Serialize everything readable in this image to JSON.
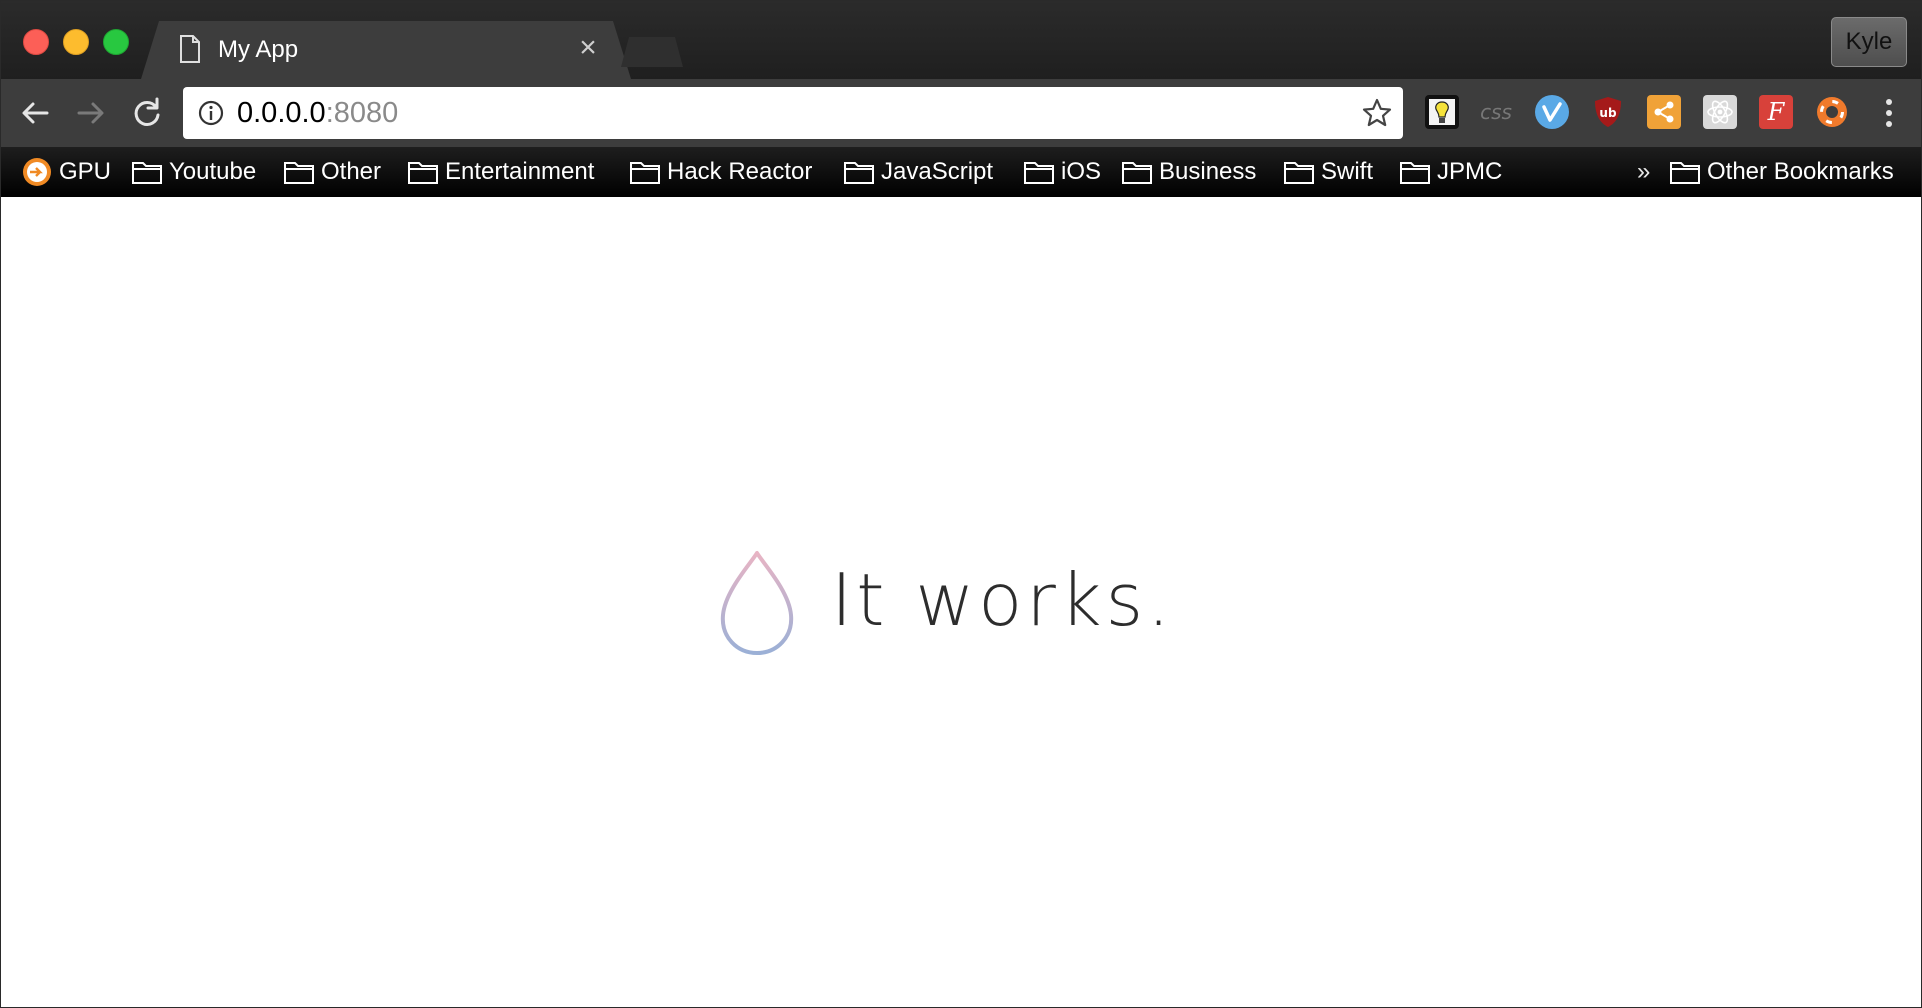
{
  "tab": {
    "title": "My App",
    "close_glyph": "×"
  },
  "profile": {
    "name": "Kyle"
  },
  "omnibox": {
    "host": "0.0.0.0",
    "port": ":8080"
  },
  "extensions": [
    {
      "name": "bulb-extension-icon",
      "label": ""
    },
    {
      "name": "css-extension-icon",
      "label": "css"
    },
    {
      "name": "vimeo-extension-icon",
      "label": ""
    },
    {
      "name": "ublock-extension-icon",
      "label": "ub"
    },
    {
      "name": "share-extension-icon",
      "label": ""
    },
    {
      "name": "react-extension-icon",
      "label": ""
    },
    {
      "name": "font-extension-icon",
      "label": "F"
    },
    {
      "name": "lifebuoy-extension-icon",
      "label": ""
    }
  ],
  "bookmarks": {
    "items": [
      {
        "label": "GPU",
        "icon": "gpu-icon"
      },
      {
        "label": "Youtube",
        "icon": "folder-icon"
      },
      {
        "label": "Other",
        "icon": "folder-icon"
      },
      {
        "label": "Entertainment",
        "icon": "folder-icon"
      },
      {
        "label": "Hack Reactor",
        "icon": "folder-icon"
      },
      {
        "label": "JavaScript",
        "icon": "folder-icon"
      },
      {
        "label": "iOS",
        "icon": "folder-icon"
      },
      {
        "label": "Business",
        "icon": "folder-icon"
      },
      {
        "label": "Swift",
        "icon": "folder-icon"
      },
      {
        "label": "JPMC",
        "icon": "folder-icon"
      }
    ],
    "overflow_glyph": "»",
    "other_bookmarks": "Other Bookmarks"
  },
  "page": {
    "headline": "It works."
  },
  "colors": {
    "tab_bg": "#3d3d3d",
    "toolbar_bg": "#3d3d3d",
    "bookmark_bar_bg": "#000000",
    "logo_gradient_top": "#e8b4c4",
    "logo_gradient_bottom": "#9bb0d6"
  }
}
